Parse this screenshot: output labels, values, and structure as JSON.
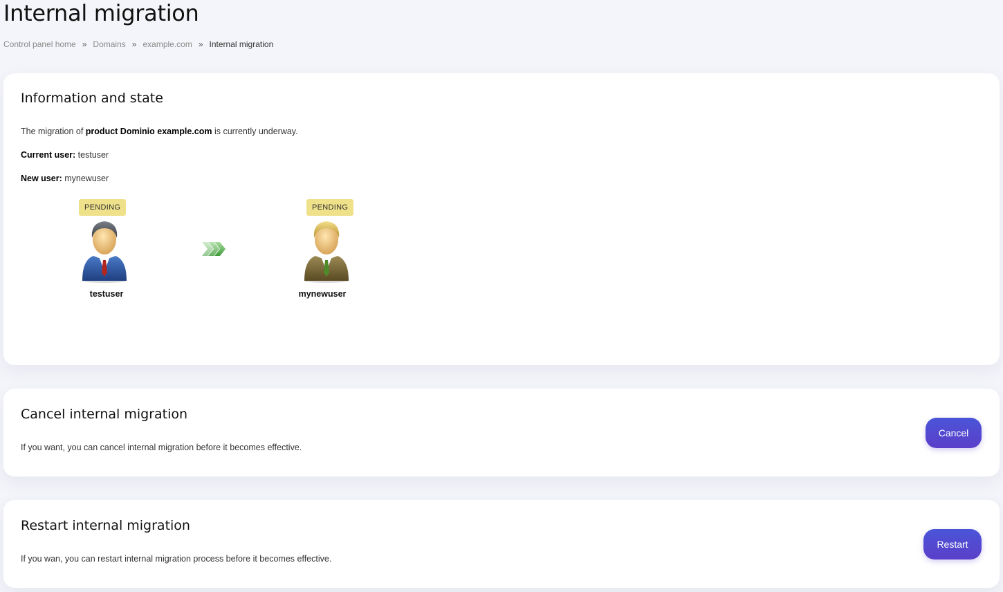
{
  "page": {
    "title": "Internal migration"
  },
  "breadcrumb": {
    "items": [
      "Control panel home",
      "Domains",
      "example.com"
    ],
    "separator": "»",
    "current": "Internal migration"
  },
  "info": {
    "heading": "Information and state",
    "migration_prefix": "The migration of ",
    "migration_product": "product Dominio example.com",
    "migration_suffix": " is currently underway.",
    "current_user_label": "Current user:",
    "current_user_value": "testuser",
    "new_user_label": "New user:",
    "new_user_value": "mynewuser",
    "source": {
      "status": "PENDING",
      "name": "testuser",
      "suit_color": "#2f5aa8"
    },
    "target": {
      "status": "PENDING",
      "name": "mynewuser",
      "suit_color": "#7a6a3a"
    }
  },
  "cancel": {
    "heading": "Cancel internal migration",
    "description": "If you want, you can cancel internal migration before it becomes effective.",
    "button_label": "Cancel"
  },
  "restart": {
    "heading": "Restart internal migration",
    "description": "If you wan, you can restart internal migration process before it becomes effective.",
    "button_label": "Restart"
  },
  "colors": {
    "accent_start": "#4a55d8",
    "accent_end": "#5b3fc9",
    "badge": "#efe08a",
    "arrow": "#4caf50"
  }
}
